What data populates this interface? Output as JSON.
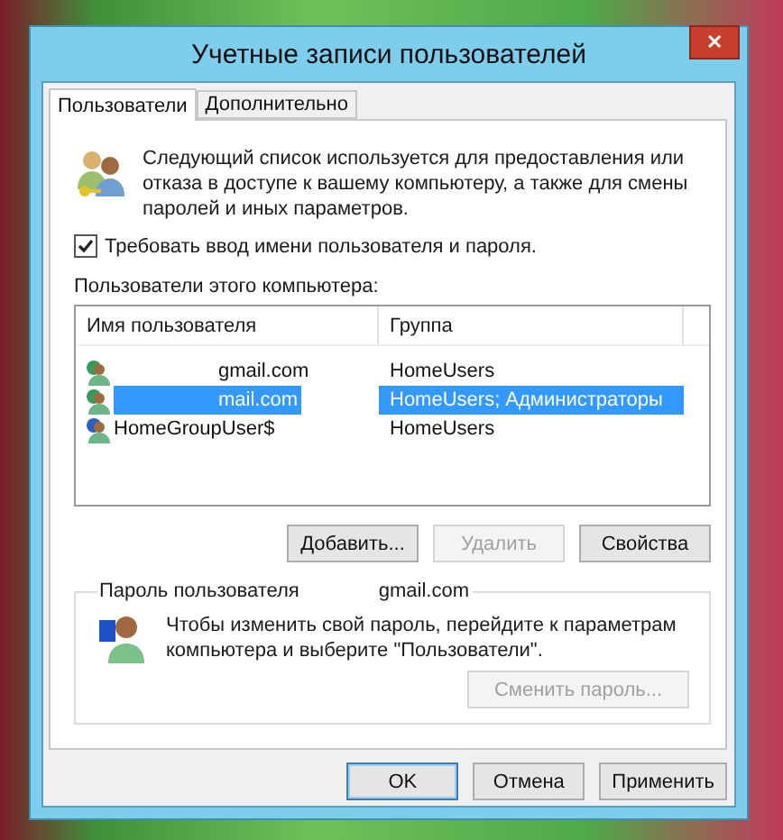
{
  "window": {
    "title": "Учетные записи пользователей",
    "close": "✕"
  },
  "tabs": [
    {
      "label": "Пользователи",
      "selected": true
    },
    {
      "label": "Дополнительно",
      "selected": false
    }
  ],
  "intro": "Следующий список используется для предоставления или отказа в доступе к вашему компьютеру, а также для смены паролей и иных параметров.",
  "require_login": {
    "label": "Требовать ввод имени пользователя и пароля.",
    "checked": true
  },
  "users_label": "Пользователи этого компьютера:",
  "table": {
    "columns": [
      "Имя пользователя",
      "Группа"
    ],
    "rows": [
      {
        "name": "gmail.com",
        "group": "HomeUsers",
        "kind": "online",
        "selected": false
      },
      {
        "name": "mail.com",
        "group": "HomeUsers; Администраторы",
        "kind": "online",
        "selected": true
      },
      {
        "name": "HomeGroupUser$",
        "group": "HomeUsers",
        "kind": "local",
        "selected": false
      }
    ]
  },
  "list_buttons": [
    {
      "label": "Добавить...",
      "disabled": false
    },
    {
      "label": "Удалить",
      "disabled": true
    },
    {
      "label": "Свойства",
      "disabled": false
    }
  ],
  "password_group": {
    "title": "Пароль пользователя",
    "account": "gmail.com",
    "text": "Чтобы изменить свой пароль, перейдите к параметрам компьютера и выберите \"Пользователи\".",
    "button": {
      "label": "Сменить пароль...",
      "disabled": true
    }
  },
  "dialog_buttons": [
    {
      "label": "OK",
      "disabled": false,
      "default": true
    },
    {
      "label": "Отмена",
      "disabled": false,
      "default": false
    },
    {
      "label": "Применить",
      "disabled": false,
      "default": false
    }
  ]
}
